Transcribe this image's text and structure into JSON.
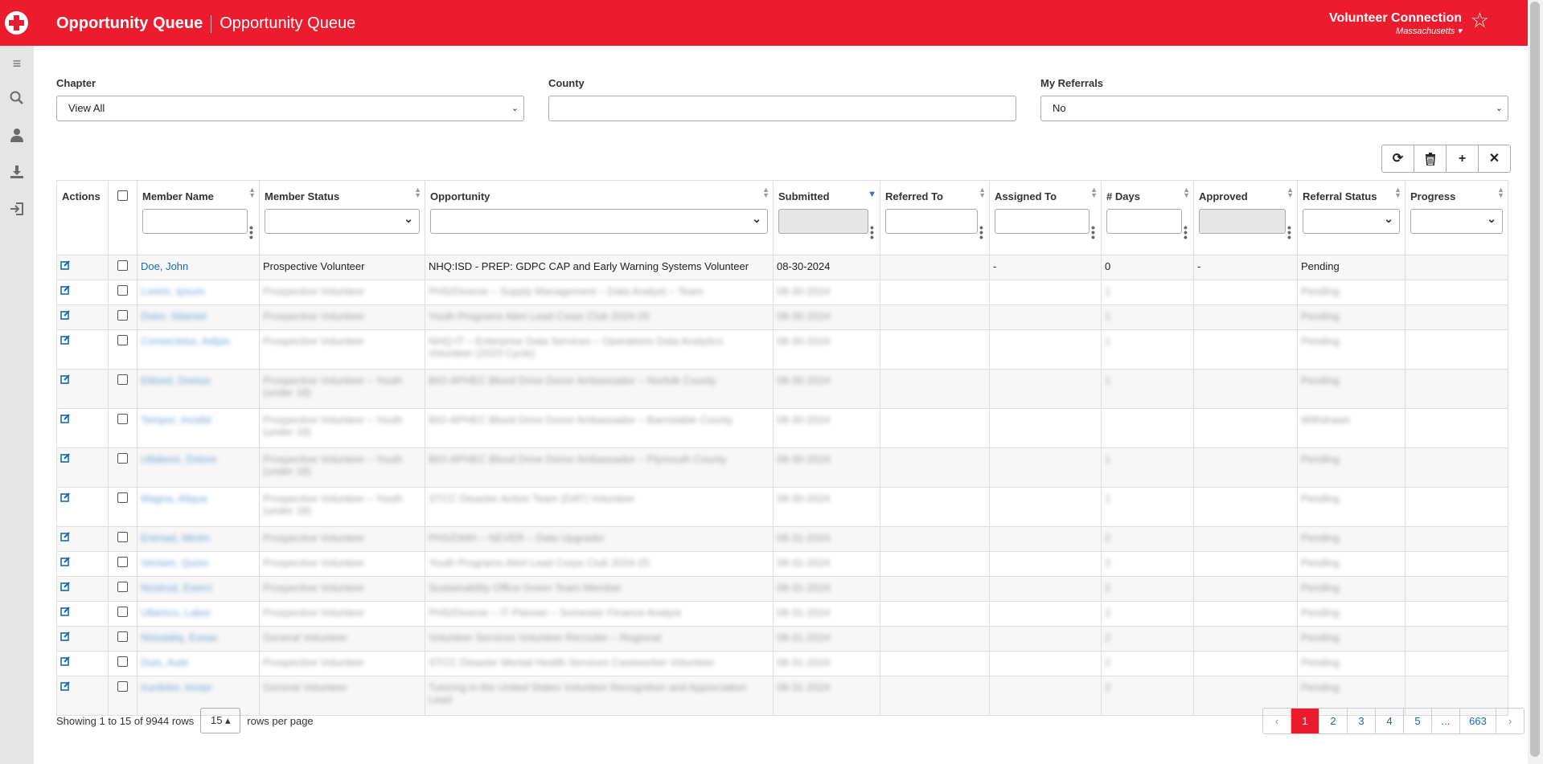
{
  "header": {
    "title_bold": "Opportunity Queue",
    "title_light": "Opportunity Queue",
    "app_name": "Volunteer Connection",
    "region": "Massachusetts",
    "brand_color": "#ed1b2e"
  },
  "sidebar": {
    "icons": [
      "menu-icon",
      "search-icon",
      "user-icon",
      "download-icon",
      "logout-icon"
    ]
  },
  "filters": {
    "chapter_label": "Chapter",
    "chapter_value": "View All",
    "county_label": "County",
    "county_value": "",
    "referrals_label": "My Referrals",
    "referrals_value": "No"
  },
  "toolbar": [
    "refresh-icon",
    "delete-icon",
    "add-icon",
    "close-icon"
  ],
  "table": {
    "columns": [
      "Actions",
      "",
      "Member Name",
      "Member Status",
      "Opportunity",
      "Submitted",
      "Referred To",
      "Assigned To",
      "# Days",
      "Approved",
      "Referral Status",
      "Progress"
    ],
    "rows": [
      {
        "name": "Doe, John",
        "status": "Prospective Volunteer",
        "opportunity": "NHQ:ISD - PREP: GDPC CAP and Early Warning Systems Volunteer",
        "submitted": "08-30-2024",
        "referred": "",
        "assigned": "-",
        "days": "0",
        "approved": "-",
        "referral_status": "Pending",
        "progress": ""
      },
      {
        "name": "Lorem, Ipsum",
        "status": "Prospective Volunteer",
        "opportunity": "PHS/Diverse – Supply Management – Data Analyst – Team",
        "submitted": "08-30-2024",
        "referred": "",
        "assigned": "",
        "days": "1",
        "approved": "",
        "referral_status": "Pending",
        "progress": ""
      },
      {
        "name": "Dolor, Sitamet",
        "status": "Prospective Volunteer",
        "opportunity": "Youth Programs Alert Lead Corps Club 2024-25",
        "submitted": "08-30-2024",
        "referred": "",
        "assigned": "",
        "days": "1",
        "approved": "",
        "referral_status": "Pending",
        "progress": ""
      },
      {
        "name": "Consectetur, Adipis",
        "status": "Prospective Volunteer",
        "opportunity": "NHQ:IT – Enterprise Data Services – Operations Data Analytics Volunteer (2023 Cycle)",
        "submitted": "08-30-2024",
        "referred": "",
        "assigned": "",
        "days": "1",
        "approved": "",
        "referral_status": "Pending",
        "progress": ""
      },
      {
        "name": "Elitsed, Doeius",
        "status": "Prospective Volunteer – Youth (under 18)",
        "opportunity": "BIO-APHEC Blood Drive Donor Ambassador – Norfolk County",
        "submitted": "08-30-2024",
        "referred": "",
        "assigned": "",
        "days": "1",
        "approved": "",
        "referral_status": "Pending",
        "progress": ""
      },
      {
        "name": "Tempor, Incidid",
        "status": "Prospective Volunteer – Youth (under 18)",
        "opportunity": "BIO-APHEC Blood Drive Donor Ambassador – Barnstable County",
        "submitted": "08-30-2024",
        "referred": "",
        "assigned": "",
        "days": "",
        "approved": "",
        "referral_status": "Withdrawn",
        "progress": ""
      },
      {
        "name": "Utlabore, Dolore",
        "status": "Prospective Volunteer – Youth (under 18)",
        "opportunity": "BIO-APHEC Blood Drive Donor Ambassador – Plymouth County",
        "submitted": "08-30-2024",
        "referred": "",
        "assigned": "",
        "days": "1",
        "approved": "",
        "referral_status": "Pending",
        "progress": ""
      },
      {
        "name": "Magna, Aliqua",
        "status": "Prospective Volunteer – Youth (under 18)",
        "opportunity": "STCC Disaster Action Team (DAT) Volunteer",
        "submitted": "08-30-2024",
        "referred": "",
        "assigned": "",
        "days": "1",
        "approved": "",
        "referral_status": "Pending",
        "progress": ""
      },
      {
        "name": "Enimad, Minim",
        "status": "Prospective Volunteer",
        "opportunity": "PHS/DMH – NEVER – Data Upgrader",
        "submitted": "08-31-2024",
        "referred": "",
        "assigned": "",
        "days": "2",
        "approved": "",
        "referral_status": "Pending",
        "progress": ""
      },
      {
        "name": "Veniam, Quisn",
        "status": "Prospective Volunteer",
        "opportunity": "Youth Programs Alert Lead Corps Club 2024-25",
        "submitted": "08-31-2024",
        "referred": "",
        "assigned": "",
        "days": "2",
        "approved": "",
        "referral_status": "Pending",
        "progress": ""
      },
      {
        "name": "Nostrud, Exerci",
        "status": "Prospective Volunteer",
        "opportunity": "Sustainability Office Green Team Member",
        "submitted": "08-31-2024",
        "referred": "",
        "assigned": "",
        "days": "2",
        "approved": "",
        "referral_status": "Pending",
        "progress": ""
      },
      {
        "name": "Ullamco, Labor",
        "status": "Prospective Volunteer",
        "opportunity": "PHS/Diverse – IT Planner – Semester Finance Analyst",
        "submitted": "08-31-2024",
        "referred": "",
        "assigned": "",
        "days": "2",
        "approved": "",
        "referral_status": "Pending",
        "progress": ""
      },
      {
        "name": "Nisiutaliq, Exeac",
        "status": "General Volunteer",
        "opportunity": "Volunteer Services Volunteer Recruiter – Regional",
        "submitted": "08-31-2024",
        "referred": "",
        "assigned": "",
        "days": "2",
        "approved": "",
        "referral_status": "Pending",
        "progress": ""
      },
      {
        "name": "Duis, Aute",
        "status": "Prospective Volunteer",
        "opportunity": "STCC Disaster Mental Health Services Caseworker Volunteer",
        "submitted": "08-31-2024",
        "referred": "",
        "assigned": "",
        "days": "2",
        "approved": "",
        "referral_status": "Pending",
        "progress": ""
      },
      {
        "name": "Irurdolor, Inrepr",
        "status": "General Volunteer",
        "opportunity": "Tutoring in the United States Volunteer Recognition and Appreciation Lead",
        "submitted": "08-31-2024",
        "referred": "",
        "assigned": "",
        "days": "2",
        "approved": "",
        "referral_status": "Pending",
        "progress": ""
      }
    ]
  },
  "footer": {
    "showing_text": "Showing 1 to 15 of 9944 rows",
    "page_size": "15 ▴",
    "per_page_text": "rows per page",
    "pages": [
      "‹",
      "1",
      "2",
      "3",
      "4",
      "5",
      "...",
      "663",
      "›"
    ]
  }
}
